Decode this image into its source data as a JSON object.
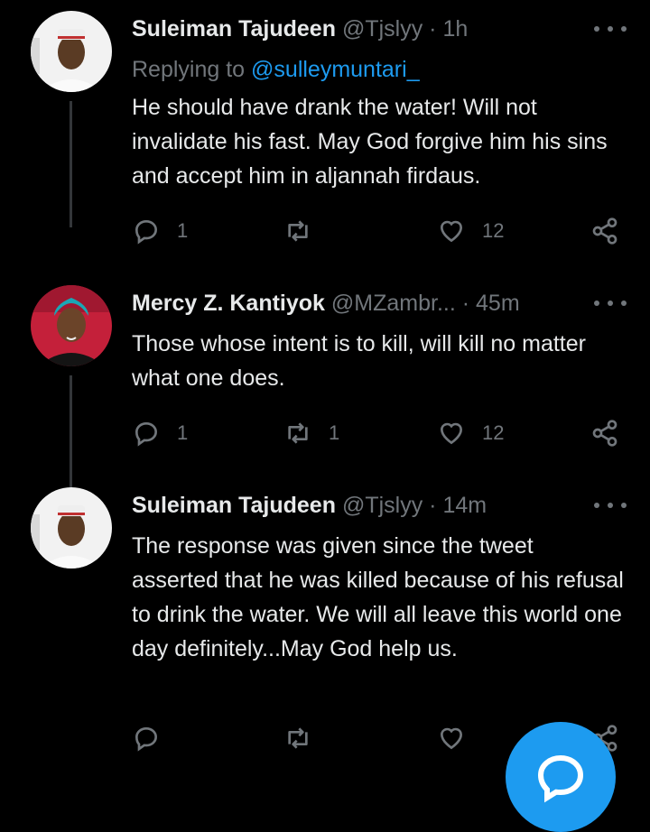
{
  "tweets": [
    {
      "name": "Suleiman Tajudeen",
      "handle": "@Tjslyy",
      "sep": "·",
      "time": "1h",
      "replying_prefix": "Replying to ",
      "replying_handle": "@sulleymuntari_",
      "text": "He should have drank the water! Will not invalidate his fast. May God forgive him his sins and accept him in aljannah firdaus.",
      "replies": "1",
      "retweets": "",
      "likes": "12"
    },
    {
      "name": "Mercy Z. Kantiyok",
      "handle": "@MZambr...",
      "sep": "·",
      "time": "45m",
      "text": "Those whose intent is to kill, will kill no matter what one does.",
      "replies": "1",
      "retweets": "1",
      "likes": "12"
    },
    {
      "name": "Suleiman Tajudeen",
      "handle": "@Tjslyy",
      "sep": "·",
      "time": "14m",
      "text": "The response was given since the tweet asserted that he was killed because of his refusal to drink the water. We will all leave this world one day definitely...May God help us.",
      "replies": "",
      "retweets": "",
      "likes": ""
    }
  ],
  "icons": {
    "reply": "reply-icon",
    "retweet": "retweet-icon",
    "like": "heart-icon",
    "share": "share-icon",
    "more": "more-icon",
    "compose": "compose-icon"
  },
  "colors": {
    "background": "#000000",
    "text": "#e7e9ea",
    "muted": "#71767b",
    "accent": "#1d9bf0"
  }
}
